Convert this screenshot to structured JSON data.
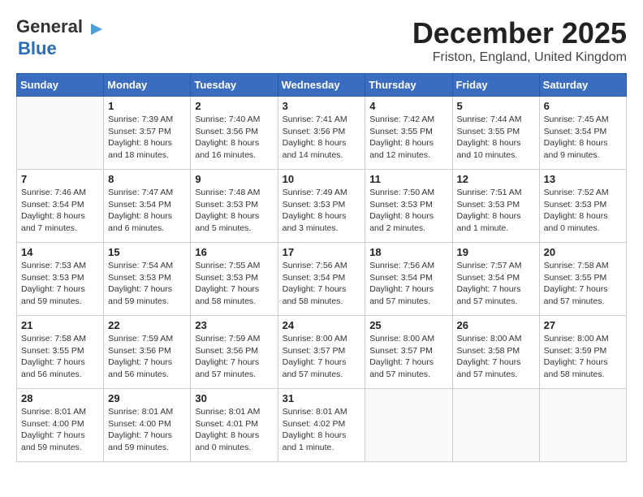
{
  "logo": {
    "line1": "General",
    "line2": "Blue"
  },
  "title": "December 2025",
  "location": "Friston, England, United Kingdom",
  "days_of_week": [
    "Sunday",
    "Monday",
    "Tuesday",
    "Wednesday",
    "Thursday",
    "Friday",
    "Saturday"
  ],
  "weeks": [
    [
      {
        "day": "",
        "info": ""
      },
      {
        "day": "1",
        "info": "Sunrise: 7:39 AM\nSunset: 3:57 PM\nDaylight: 8 hours\nand 18 minutes."
      },
      {
        "day": "2",
        "info": "Sunrise: 7:40 AM\nSunset: 3:56 PM\nDaylight: 8 hours\nand 16 minutes."
      },
      {
        "day": "3",
        "info": "Sunrise: 7:41 AM\nSunset: 3:56 PM\nDaylight: 8 hours\nand 14 minutes."
      },
      {
        "day": "4",
        "info": "Sunrise: 7:42 AM\nSunset: 3:55 PM\nDaylight: 8 hours\nand 12 minutes."
      },
      {
        "day": "5",
        "info": "Sunrise: 7:44 AM\nSunset: 3:55 PM\nDaylight: 8 hours\nand 10 minutes."
      },
      {
        "day": "6",
        "info": "Sunrise: 7:45 AM\nSunset: 3:54 PM\nDaylight: 8 hours\nand 9 minutes."
      }
    ],
    [
      {
        "day": "7",
        "info": "Sunrise: 7:46 AM\nSunset: 3:54 PM\nDaylight: 8 hours\nand 7 minutes."
      },
      {
        "day": "8",
        "info": "Sunrise: 7:47 AM\nSunset: 3:54 PM\nDaylight: 8 hours\nand 6 minutes."
      },
      {
        "day": "9",
        "info": "Sunrise: 7:48 AM\nSunset: 3:53 PM\nDaylight: 8 hours\nand 5 minutes."
      },
      {
        "day": "10",
        "info": "Sunrise: 7:49 AM\nSunset: 3:53 PM\nDaylight: 8 hours\nand 3 minutes."
      },
      {
        "day": "11",
        "info": "Sunrise: 7:50 AM\nSunset: 3:53 PM\nDaylight: 8 hours\nand 2 minutes."
      },
      {
        "day": "12",
        "info": "Sunrise: 7:51 AM\nSunset: 3:53 PM\nDaylight: 8 hours\nand 1 minute."
      },
      {
        "day": "13",
        "info": "Sunrise: 7:52 AM\nSunset: 3:53 PM\nDaylight: 8 hours\nand 0 minutes."
      }
    ],
    [
      {
        "day": "14",
        "info": "Sunrise: 7:53 AM\nSunset: 3:53 PM\nDaylight: 7 hours\nand 59 minutes."
      },
      {
        "day": "15",
        "info": "Sunrise: 7:54 AM\nSunset: 3:53 PM\nDaylight: 7 hours\nand 59 minutes."
      },
      {
        "day": "16",
        "info": "Sunrise: 7:55 AM\nSunset: 3:53 PM\nDaylight: 7 hours\nand 58 minutes."
      },
      {
        "day": "17",
        "info": "Sunrise: 7:56 AM\nSunset: 3:54 PM\nDaylight: 7 hours\nand 58 minutes."
      },
      {
        "day": "18",
        "info": "Sunrise: 7:56 AM\nSunset: 3:54 PM\nDaylight: 7 hours\nand 57 minutes."
      },
      {
        "day": "19",
        "info": "Sunrise: 7:57 AM\nSunset: 3:54 PM\nDaylight: 7 hours\nand 57 minutes."
      },
      {
        "day": "20",
        "info": "Sunrise: 7:58 AM\nSunset: 3:55 PM\nDaylight: 7 hours\nand 57 minutes."
      }
    ],
    [
      {
        "day": "21",
        "info": "Sunrise: 7:58 AM\nSunset: 3:55 PM\nDaylight: 7 hours\nand 56 minutes."
      },
      {
        "day": "22",
        "info": "Sunrise: 7:59 AM\nSunset: 3:56 PM\nDaylight: 7 hours\nand 56 minutes."
      },
      {
        "day": "23",
        "info": "Sunrise: 7:59 AM\nSunset: 3:56 PM\nDaylight: 7 hours\nand 57 minutes."
      },
      {
        "day": "24",
        "info": "Sunrise: 8:00 AM\nSunset: 3:57 PM\nDaylight: 7 hours\nand 57 minutes."
      },
      {
        "day": "25",
        "info": "Sunrise: 8:00 AM\nSunset: 3:57 PM\nDaylight: 7 hours\nand 57 minutes."
      },
      {
        "day": "26",
        "info": "Sunrise: 8:00 AM\nSunset: 3:58 PM\nDaylight: 7 hours\nand 57 minutes."
      },
      {
        "day": "27",
        "info": "Sunrise: 8:00 AM\nSunset: 3:59 PM\nDaylight: 7 hours\nand 58 minutes."
      }
    ],
    [
      {
        "day": "28",
        "info": "Sunrise: 8:01 AM\nSunset: 4:00 PM\nDaylight: 7 hours\nand 59 minutes."
      },
      {
        "day": "29",
        "info": "Sunrise: 8:01 AM\nSunset: 4:00 PM\nDaylight: 7 hours\nand 59 minutes."
      },
      {
        "day": "30",
        "info": "Sunrise: 8:01 AM\nSunset: 4:01 PM\nDaylight: 8 hours\nand 0 minutes."
      },
      {
        "day": "31",
        "info": "Sunrise: 8:01 AM\nSunset: 4:02 PM\nDaylight: 8 hours\nand 1 minute."
      },
      {
        "day": "",
        "info": ""
      },
      {
        "day": "",
        "info": ""
      },
      {
        "day": "",
        "info": ""
      }
    ]
  ]
}
